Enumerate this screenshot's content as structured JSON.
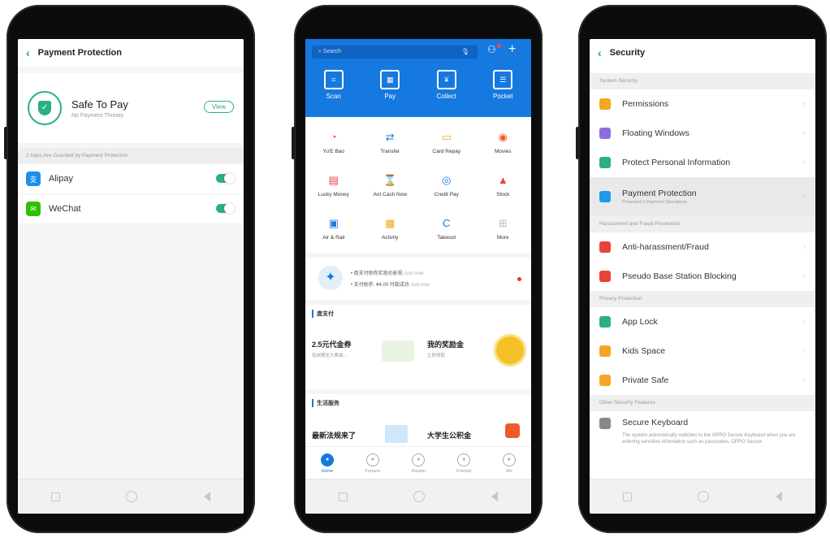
{
  "phone1": {
    "title": "Payment Protection",
    "back_icon": "chevron-left-icon",
    "safe_title": "Safe To Pay",
    "safe_subtitle": "No Payment Threats",
    "view_button": "View",
    "section_label": "2 Apps Are Guarded by Payment Protection",
    "apps": [
      {
        "name": "Alipay",
        "icon": "alipay-icon",
        "color": "#1e8ee6",
        "enabled": true
      },
      {
        "name": "WeChat",
        "icon": "wechat-icon",
        "color": "#2dc100",
        "enabled": true
      }
    ],
    "accent": "#2bb07f"
  },
  "phone2": {
    "search_placeholder": "Search",
    "quick": [
      {
        "label": "Scan",
        "icon": "scan-icon"
      },
      {
        "label": "Pay",
        "icon": "pay-icon"
      },
      {
        "label": "Collect",
        "icon": "collect-icon"
      },
      {
        "label": "Pocket",
        "icon": "pocket-icon"
      }
    ],
    "grid": [
      {
        "label": "Yu'E Bao",
        "icon": "yuebao-icon",
        "color": "#f05a2b",
        "glyph": "◔"
      },
      {
        "label": "Transfer",
        "icon": "transfer-icon",
        "color": "#1679e0",
        "glyph": "⇄"
      },
      {
        "label": "Card Repay",
        "icon": "card-repay-icon",
        "color": "#f2a51a",
        "glyph": "▭"
      },
      {
        "label": "Movies",
        "icon": "movies-icon",
        "color": "#f05a2b",
        "glyph": "◉"
      },
      {
        "label": "Lucky Money",
        "icon": "lucky-money-icon",
        "color": "#e8433a",
        "glyph": "▤"
      },
      {
        "label": "Ant Cash Now",
        "icon": "ant-cash-icon",
        "color": "#888888",
        "glyph": "⌛"
      },
      {
        "label": "Credit Pay",
        "icon": "credit-pay-icon",
        "color": "#1679e0",
        "glyph": "◎"
      },
      {
        "label": "Stock",
        "icon": "stock-icon",
        "color": "#e8433a",
        "glyph": "▲"
      },
      {
        "label": "Air & Rail",
        "icon": "air-rail-icon",
        "color": "#1679e0",
        "glyph": "▣"
      },
      {
        "label": "Activity",
        "icon": "activity-icon",
        "color": "#f2a51a",
        "glyph": "▦"
      },
      {
        "label": "Takeout",
        "icon": "takeout-icon",
        "color": "#1679e0",
        "glyph": "C"
      },
      {
        "label": "More",
        "icon": "more-grid-icon",
        "color": "#bbbbbb",
        "glyph": "⊞"
      }
    ],
    "banner": {
      "line1": "• 商支付助你实现价影视",
      "line1_time": "Just now",
      "line2": "• 支付助手: ¥4.00 付款成功",
      "line2_time": "Just now"
    },
    "section1": {
      "title": "度支付",
      "card1_title": "2.5元代金券",
      "card1_sub": "有效期至大票城...",
      "card2_title": "我的奖励金",
      "card2_sub": "立即领取"
    },
    "section2": {
      "title": "生活服务",
      "card1_title": "最新法规来了",
      "card2_title": "大学生公积金"
    },
    "tabs": [
      {
        "label": "Home",
        "icon": "home-icon",
        "active": true
      },
      {
        "label": "Fortune",
        "icon": "fortune-icon",
        "active": false
      },
      {
        "label": "Koubei",
        "icon": "koubei-icon",
        "active": false
      },
      {
        "label": "Friends",
        "icon": "friends-icon",
        "active": false
      },
      {
        "label": "Me",
        "icon": "me-icon",
        "active": false
      }
    ],
    "brand_color": "#1679e0"
  },
  "phone3": {
    "title": "Security",
    "groups": [
      {
        "label": "System Security",
        "items": [
          {
            "label": "Permissions",
            "icon": "permissions-icon",
            "color": "#f6a623"
          },
          {
            "label": "Floating Windows",
            "icon": "floating-windows-icon",
            "color": "#8e6de0"
          },
          {
            "label": "Protect Personal Information",
            "icon": "protect-info-icon",
            "color": "#2bb07f"
          },
          {
            "label": "Payment Protection",
            "sub": "Protected 3 Payment Operations",
            "icon": "payment-protection-icon",
            "color": "#1e9be6",
            "selected": true
          }
        ]
      },
      {
        "label": "Harassment and Fraud Prevention",
        "items": [
          {
            "label": "Anti-harassment/Fraud",
            "icon": "anti-harassment-icon",
            "color": "#e8433a"
          },
          {
            "label": "Pseudo Base Station Blocking",
            "icon": "pseudo-base-station-icon",
            "color": "#e8433a"
          }
        ]
      },
      {
        "label": "Privacy Protection",
        "items": [
          {
            "label": "App Lock",
            "icon": "app-lock-icon",
            "color": "#2bb07f"
          },
          {
            "label": "Kids Space",
            "icon": "kids-space-icon",
            "color": "#f6a623"
          },
          {
            "label": "Private Safe",
            "icon": "private-safe-icon",
            "color": "#f6a623"
          }
        ]
      },
      {
        "label": "Other Security Features",
        "items": [
          {
            "label": "Secure Keyboard",
            "icon": "secure-keyboard-icon",
            "color": "#888888",
            "desc": "The system automatically switches to the OPPO Secure Keyboard when you are entering sensitive information such as passcodes. OPPO Secure"
          }
        ]
      }
    ]
  }
}
